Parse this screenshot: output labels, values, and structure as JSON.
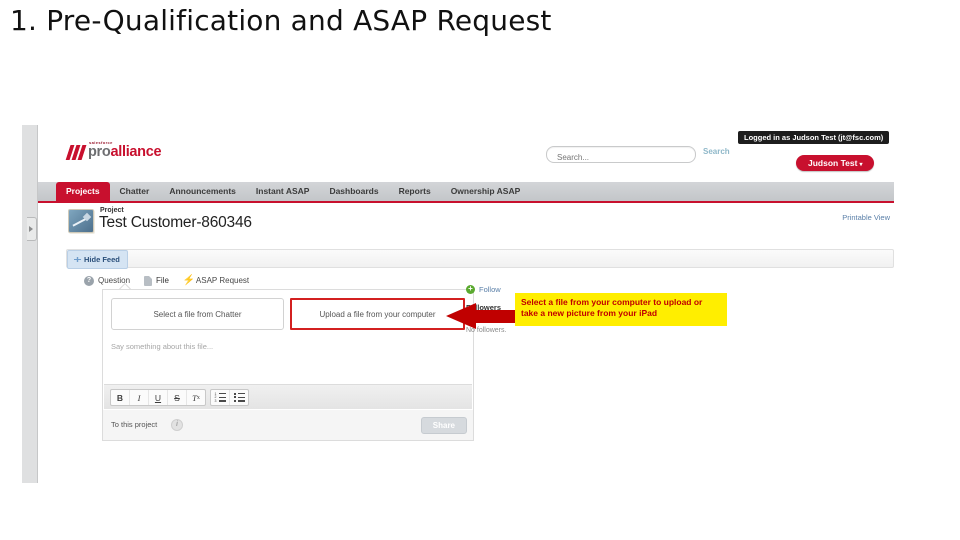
{
  "slide": {
    "title": "1. Pre-Qualification and ASAP Request"
  },
  "app": {
    "logo": {
      "tagline": "salesforce",
      "word_a": "pro",
      "word_b": "alliance"
    },
    "search": {
      "placeholder": "Search...",
      "value": "",
      "button_label": "Search"
    },
    "logged_in_banner": "Logged in as Judson Test (jt@fsc.com)",
    "user_menu": {
      "label": "Judson Test",
      "caret": "▾"
    },
    "nav_tabs": [
      {
        "label": "Projects",
        "active": true
      },
      {
        "label": "Chatter",
        "active": false
      },
      {
        "label": "Announcements",
        "active": false
      },
      {
        "label": "Instant ASAP",
        "active": false
      },
      {
        "label": "Dashboards",
        "active": false
      },
      {
        "label": "Reports",
        "active": false
      },
      {
        "label": "Ownership ASAP",
        "active": false
      }
    ]
  },
  "record": {
    "kicker": "Project",
    "title": "Test Customer-860346",
    "printable_view": "Printable View",
    "hide_feed": "Hide Feed"
  },
  "publisher": {
    "tabs": [
      {
        "label": "Question",
        "icon": "question-circle-icon",
        "active": false
      },
      {
        "label": "File",
        "icon": "file-icon",
        "active": true
      },
      {
        "label": "ASAP Request",
        "icon": "lightning-bolt-icon",
        "active": false
      }
    ],
    "file_options": [
      {
        "label": "Select a file from Chatter",
        "highlighted": false
      },
      {
        "label": "Upload a file from your computer",
        "highlighted": true
      }
    ],
    "comment_placeholder": "Say something about this file...",
    "comment_value": "",
    "format_buttons": [
      {
        "name": "bold",
        "glyph": "B"
      },
      {
        "name": "italic",
        "glyph": "I"
      },
      {
        "name": "underline",
        "glyph": "U"
      },
      {
        "name": "strikethrough",
        "glyph": "S"
      },
      {
        "name": "clear-formatting",
        "glyph": "T",
        "sub": "x"
      }
    ],
    "list_buttons": [
      {
        "name": "numbered-list"
      },
      {
        "name": "bulleted-list"
      }
    ],
    "scope_label": "To this project",
    "share_label": "Share"
  },
  "follow": {
    "follow_label": "Follow",
    "followers_heading": "Followers",
    "no_followers": "No followers."
  },
  "annotation": {
    "callout_text": "Select a file from your computer to upload or take a new picture from your iPad",
    "callout_bg": "#ffee00",
    "callout_color": "#c00000",
    "arrow_color": "#c00000",
    "highlight_border_color": "#d32020"
  }
}
